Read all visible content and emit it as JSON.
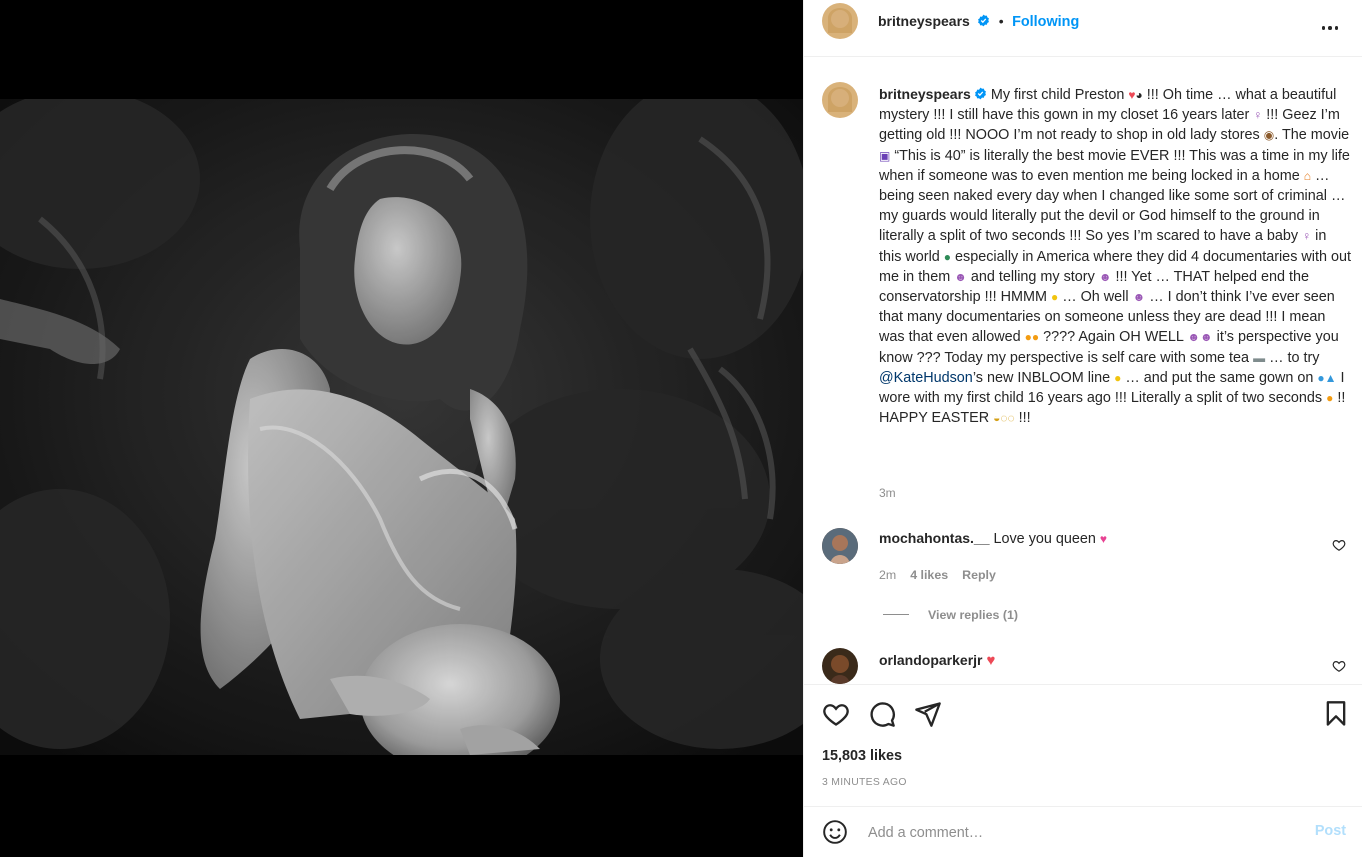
{
  "post": {
    "username": "britneyspears",
    "follow_label": "Following",
    "separator": "•",
    "caption_parts": {
      "p1": "My first child Preston",
      "p2": "!!! Oh time … what a beautiful mystery !!! I still have this gown in my closet 16 years later",
      "p3": "!!! Geez I’m getting old !!! NOOO I’m not ready to shop in old lady stores",
      "p4": ". The movie",
      "p5": "“This is 40” is literally the best movie EVER !!! This was a time in my life when if someone was to even mention me being locked in a home",
      "p6": "… being seen naked every day when I changed like some sort of criminal … my guards would literally put the devil or God himself to the ground in literally a split of two seconds !!! So yes I’m scared to have a baby",
      "p7": "in this world",
      "p8": "especially in America where they did 4 documentaries with out me in them",
      "p9": "and telling my story",
      "p10": "!!! Yet … THAT helped end the conservatorship !!! HMMM",
      "p11": "… Oh well",
      "p12": "… I don’t think I’ve ever seen that many documentaries on someone unless they are dead !!! I mean was that even allowed",
      "p13": "???? Again OH WELL",
      "p14": "it’s perspective you know ??? Today my perspective is self care with some tea",
      "p15": "… to try",
      "mention": "@KateHudson",
      "p16": "’s new INBLOOM line",
      "p17": "… and put the same gown on",
      "p18": "I wore with my first child 16 years ago !!! Literally a split of two seconds",
      "p19": "!! HAPPY EASTER",
      "p20": "!!!"
    },
    "caption_time": "3m",
    "likes": "15,803 likes",
    "posted_ago": "3 MINUTES AGO"
  },
  "comments": [
    {
      "username": "mochahontas.__",
      "text": "Love you queen",
      "time": "2m",
      "likes": "4 likes",
      "reply_label": "Reply",
      "view_replies": "View replies (1)"
    },
    {
      "username": "orlandoparkerjr",
      "text": ""
    }
  ],
  "composer": {
    "placeholder": "Add a comment…",
    "post_label": "Post"
  },
  "icons": [
    "verified-badge-icon",
    "more-options-icon",
    "like-icon",
    "comment-icon",
    "share-icon",
    "save-icon",
    "emoji-icon",
    "heart-icon"
  ],
  "colors": {
    "accent": "#0095f6",
    "link": "#00376b",
    "like_red": "#ed4956",
    "muted": "#8e8e8e"
  }
}
